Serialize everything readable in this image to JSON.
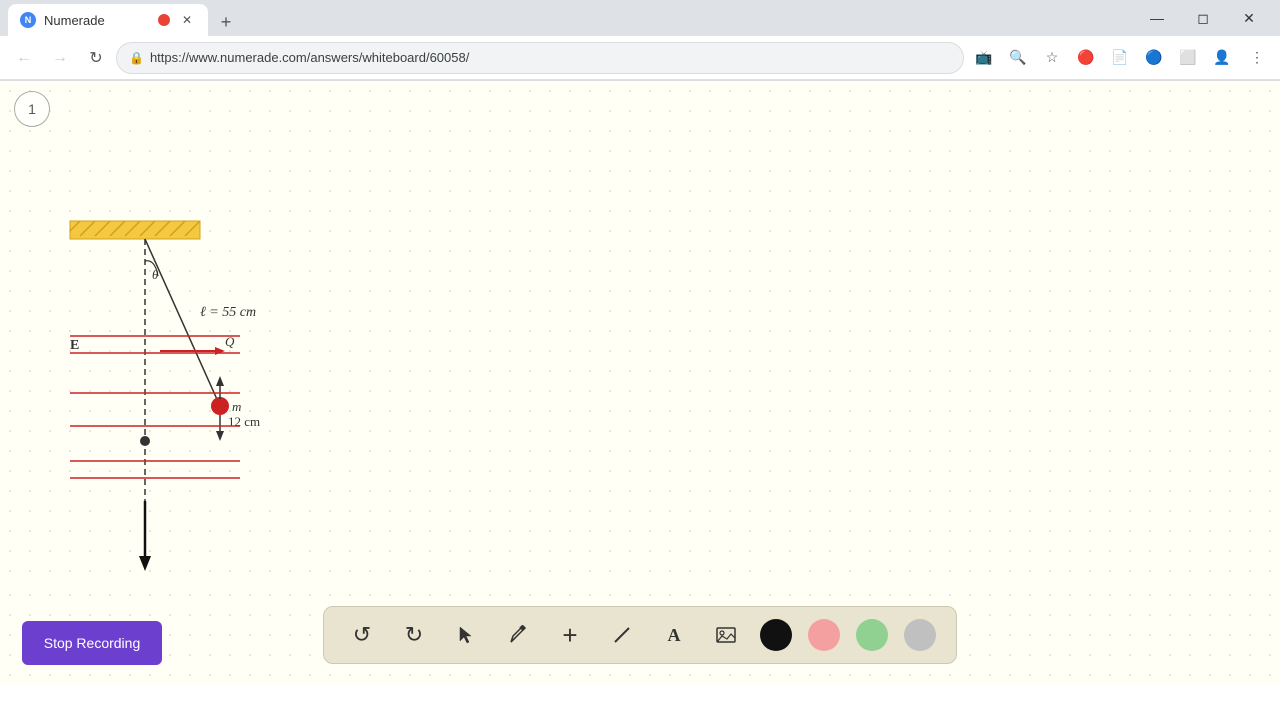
{
  "browser": {
    "tab_label": "Numerade",
    "tab_favicon": "N",
    "address": "https://www.numerade.com/answers/whiteboard/60058/",
    "new_tab_tooltip": "New tab"
  },
  "page_number": "1",
  "diagram": {
    "length_label": "ℓ = 55 cm",
    "theta_label": "θ",
    "E_label": "E",
    "Q_label": "Q",
    "m_label": "m",
    "distance_label": "12 cm"
  },
  "toolbar": {
    "undo_label": "↺",
    "redo_label": "↻",
    "select_label": "▲",
    "pen_label": "✏",
    "add_label": "+",
    "eraser_label": "/",
    "text_label": "A",
    "image_label": "🖼",
    "colors": [
      "#111111",
      "#f4a0a0",
      "#90d090",
      "#c0c0c0"
    ]
  },
  "stop_recording": {
    "label": "Stop Recording"
  }
}
